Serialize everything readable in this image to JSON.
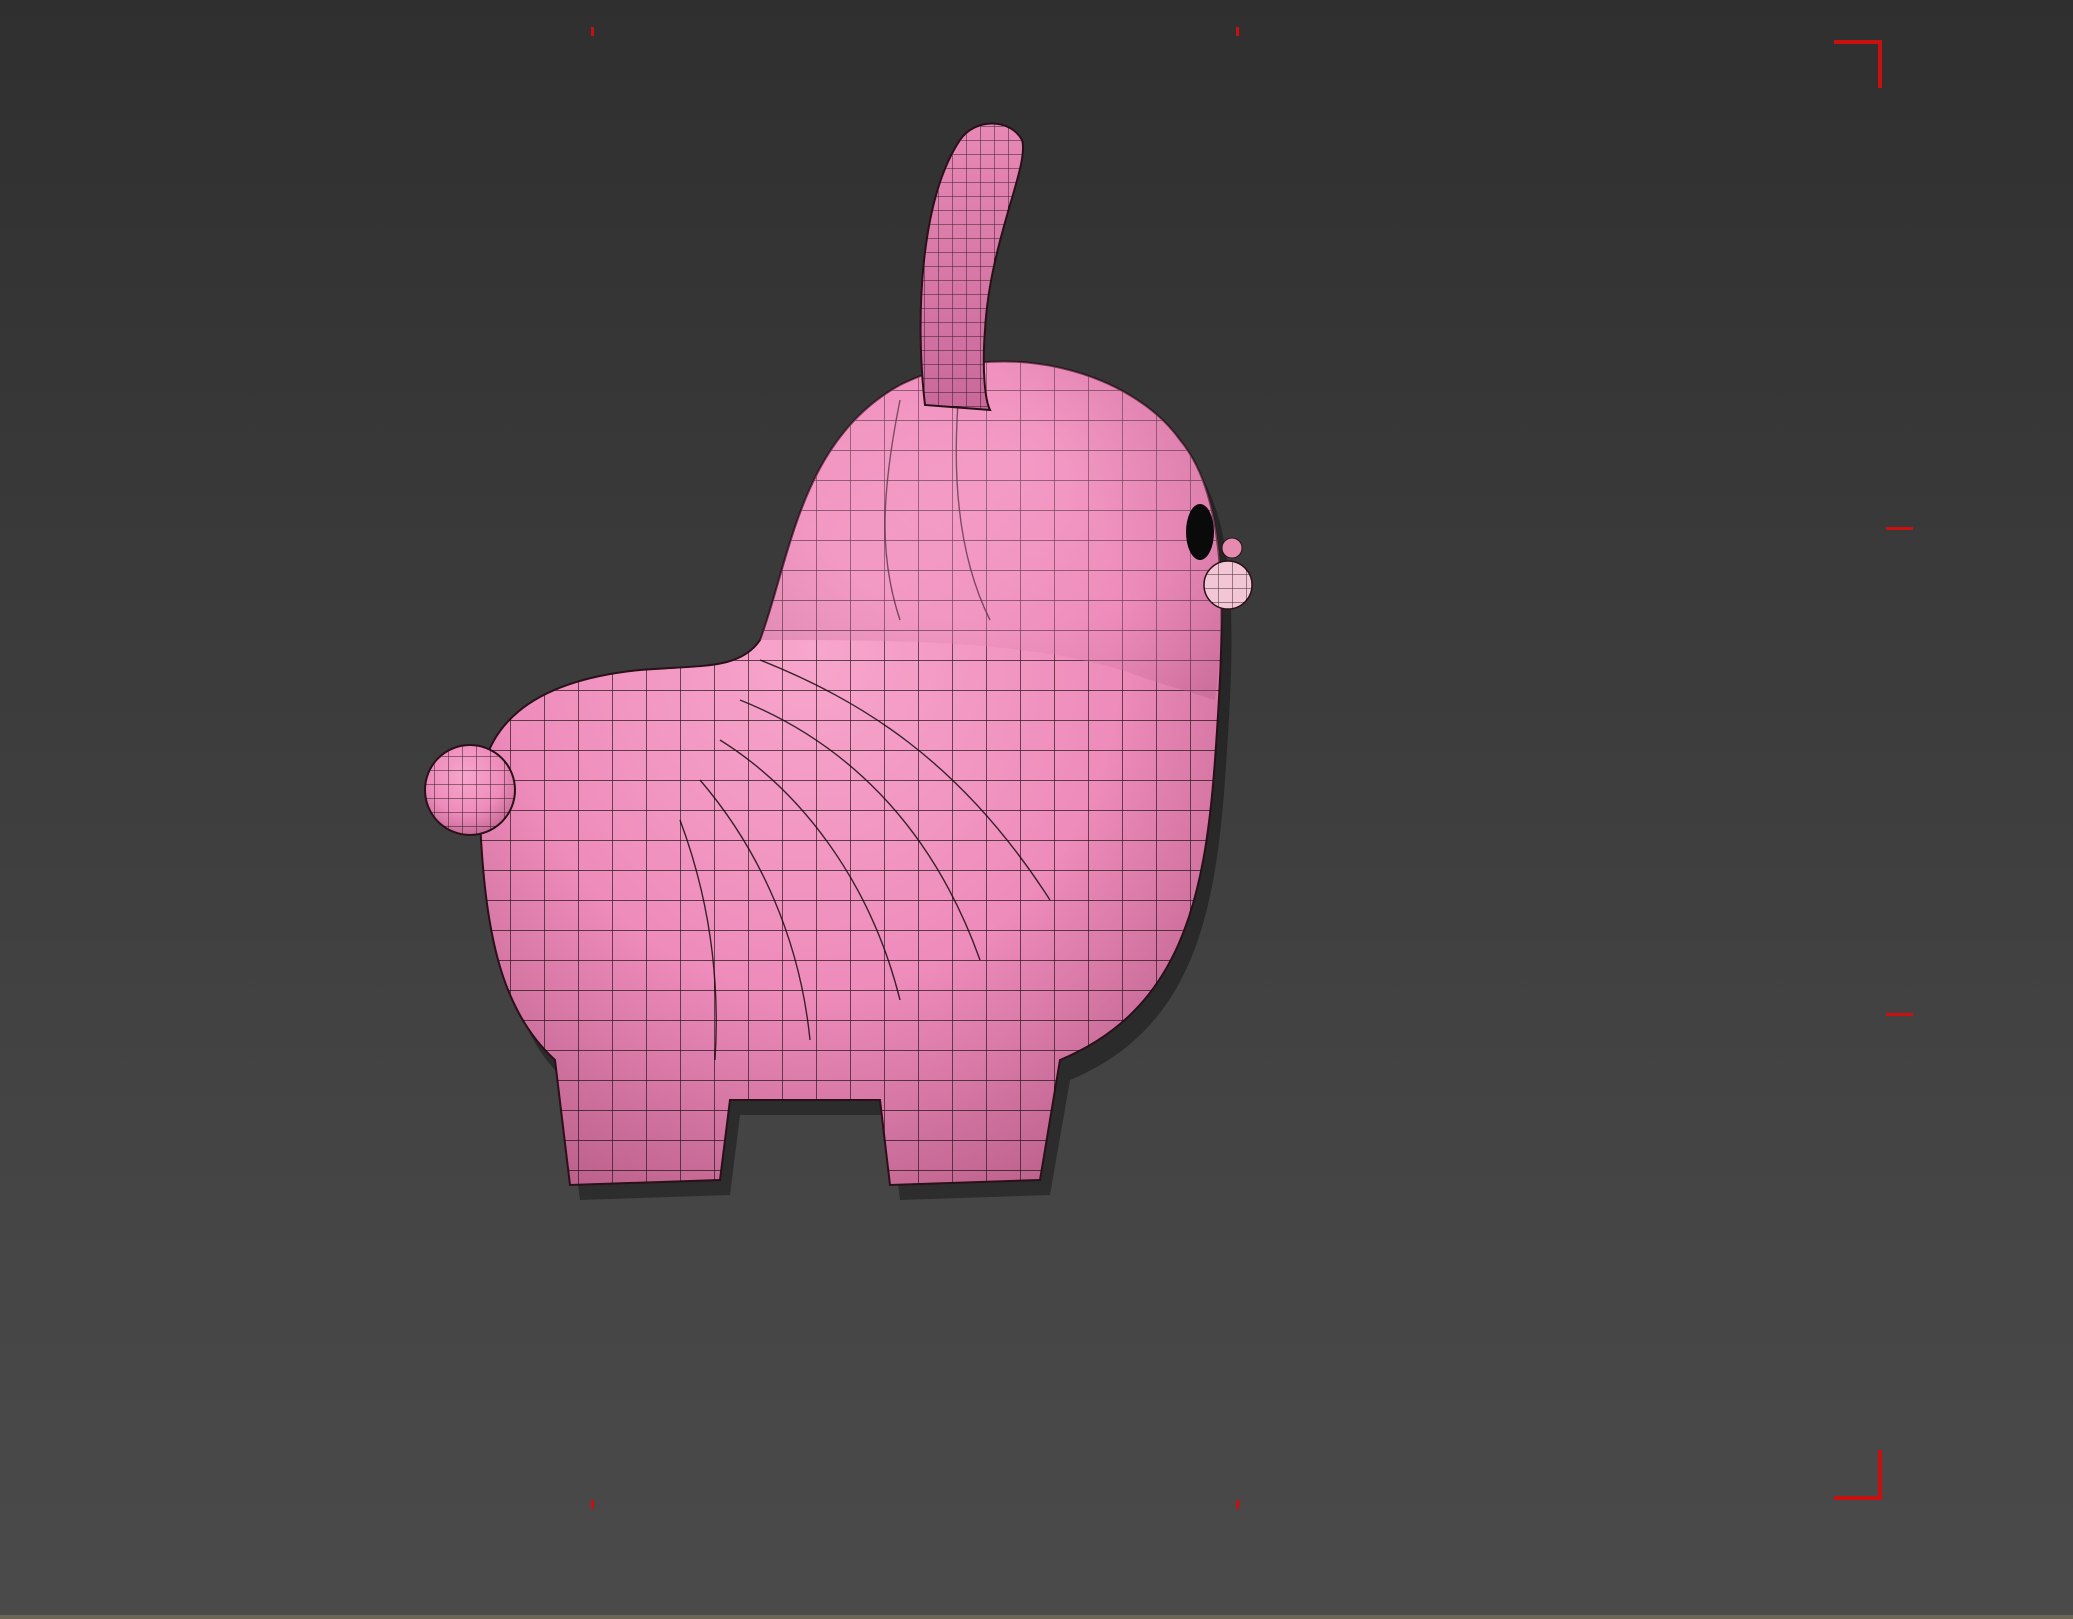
{
  "viewport": {
    "background_top": "#2f2f2f",
    "background_bottom": "#4a4a4a",
    "safe_frame_color": "#c81010"
  },
  "model": {
    "name": "pink-cartoon-creature",
    "shading": "wireframe-on-shaded",
    "surface_color": "#f08cbe",
    "wire_color": "#1a0d12",
    "eye_color": "#0a0a0a",
    "nose_color": "#f3c6d6"
  }
}
